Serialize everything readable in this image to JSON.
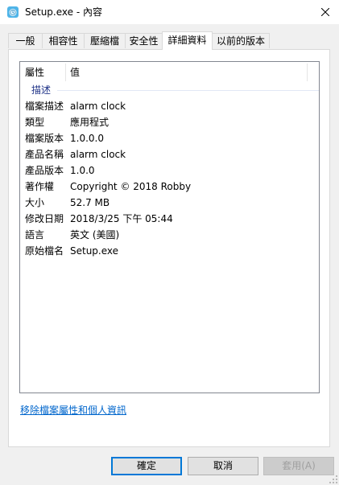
{
  "window": {
    "title": "Setup.exe - 內容",
    "icon": "alarm-clock-app-icon",
    "close_icon": "close-icon"
  },
  "tabs": [
    {
      "label": "一般",
      "active": false
    },
    {
      "label": "相容性",
      "active": false
    },
    {
      "label": "壓縮檔",
      "active": false
    },
    {
      "label": "安全性",
      "active": false
    },
    {
      "label": "詳細資料",
      "active": true
    },
    {
      "label": "以前的版本",
      "active": false
    }
  ],
  "details": {
    "columns": {
      "property": "屬性",
      "value": "值"
    },
    "group_label": "描述",
    "rows": [
      {
        "name": "檔案描述",
        "value": "alarm clock"
      },
      {
        "name": "類型",
        "value": "應用程式"
      },
      {
        "name": "檔案版本",
        "value": "1.0.0.0"
      },
      {
        "name": "產品名稱",
        "value": "alarm clock"
      },
      {
        "name": "產品版本",
        "value": "1.0.0"
      },
      {
        "name": "著作權",
        "value": "Copyright © 2018 Robby"
      },
      {
        "name": "大小",
        "value": "52.7 MB"
      },
      {
        "name": "修改日期",
        "value": "2018/3/25 下午 05:44"
      },
      {
        "name": "語言",
        "value": "英文 (美國)"
      },
      {
        "name": "原始檔名",
        "value": "Setup.exe"
      }
    ],
    "remove_link": "移除檔案屬性和個人資訊"
  },
  "buttons": {
    "ok": "確定",
    "cancel": "取消",
    "apply": "套用(A)"
  },
  "colors": {
    "accent": "#0078d7",
    "link": "#0066cc",
    "group_label": "#1e3287"
  }
}
